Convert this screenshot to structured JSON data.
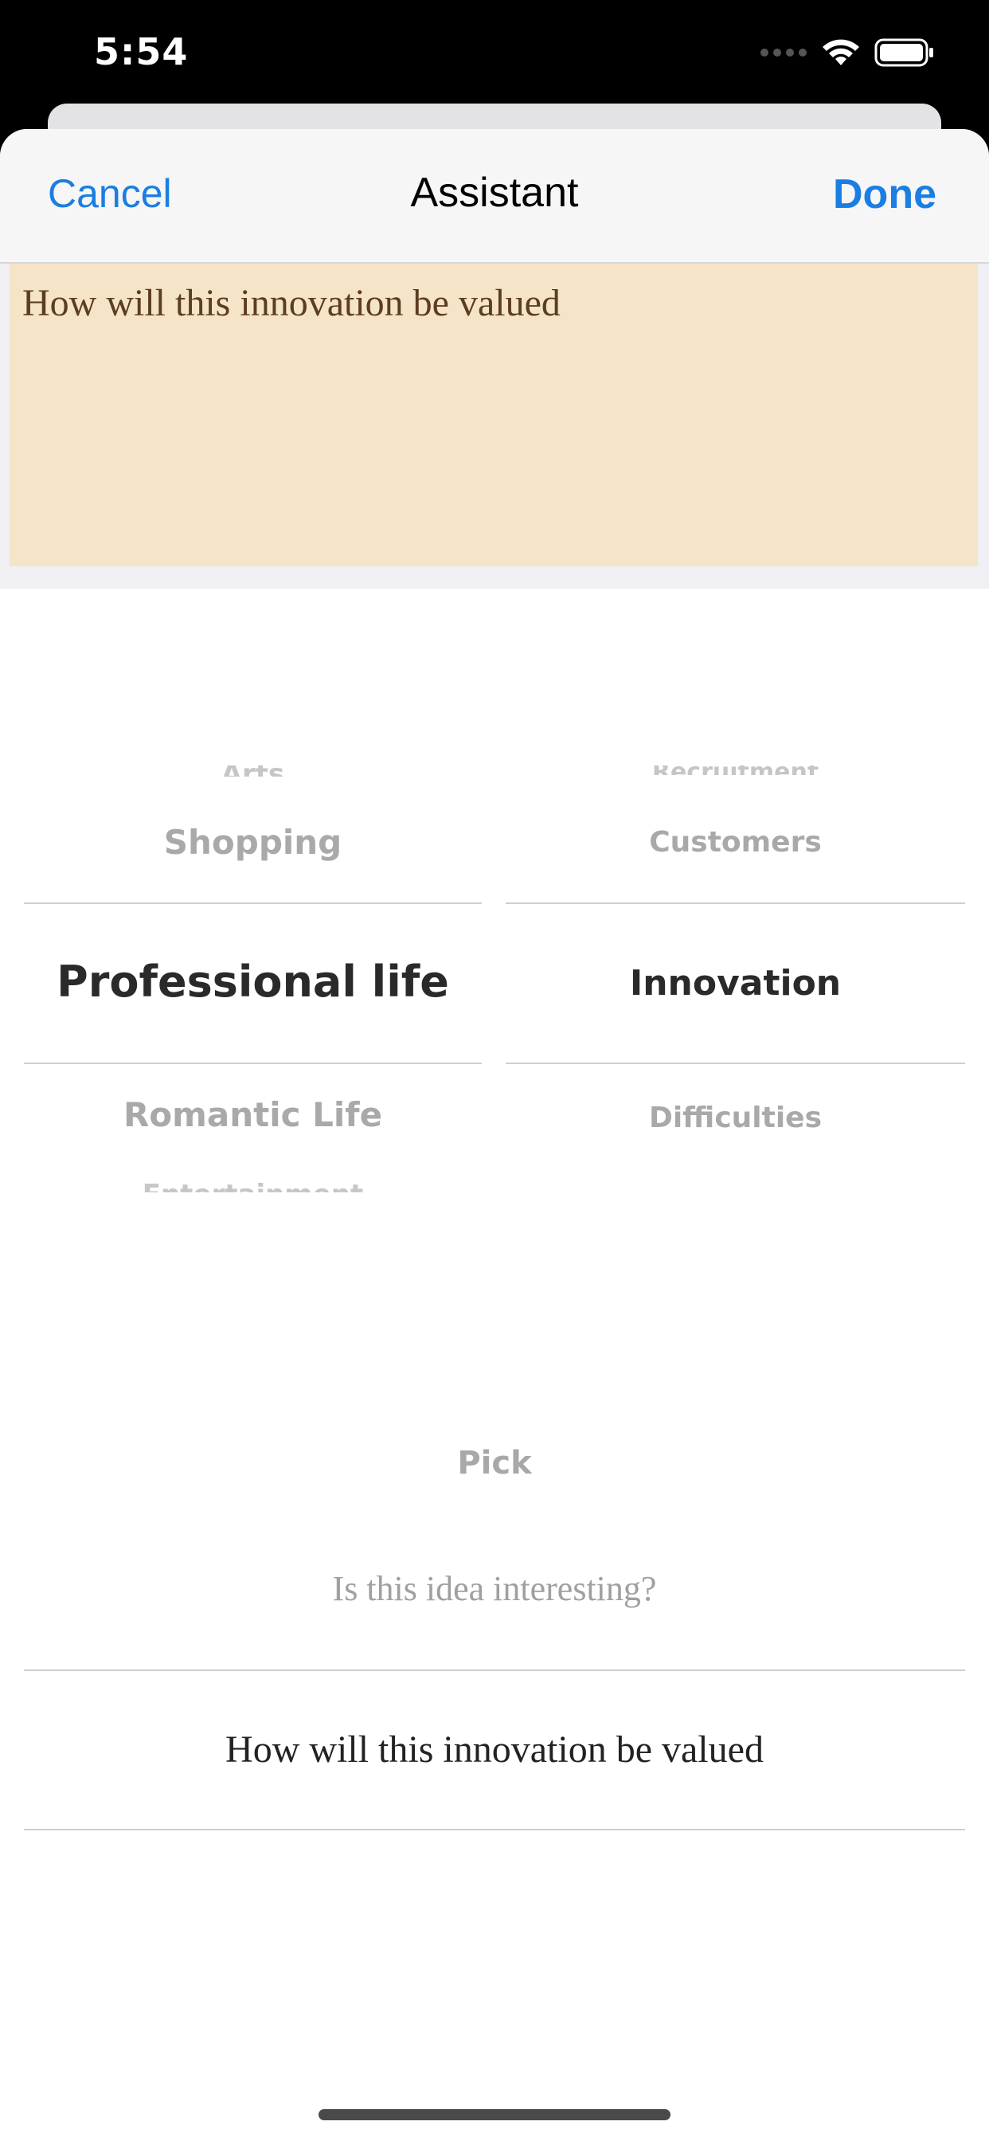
{
  "status_bar": {
    "time": "5:54",
    "icons": [
      "signal-icon",
      "wifi-icon",
      "battery-icon"
    ]
  },
  "nav": {
    "cancel_label": "Cancel",
    "title": "Assistant",
    "done_label": "Done"
  },
  "editor": {
    "text": "How will this innovation be valued",
    "background": "#f6e4c8"
  },
  "picker_left": {
    "items": [
      "Arts",
      "Shopping",
      "Professional life",
      "Romantic Life",
      "Entertainment"
    ],
    "selected": "Professional life"
  },
  "picker_right": {
    "items": [
      "Recruitment",
      "Customers",
      "Innovation",
      "Difficulties"
    ],
    "selected": "Innovation"
  },
  "question_picker": {
    "label": "Pick",
    "items": [
      "Is this idea interesting?",
      "How will this innovation be valued"
    ],
    "selected": "How will this innovation be valued"
  },
  "colors": {
    "accent": "#1a7ee3"
  }
}
